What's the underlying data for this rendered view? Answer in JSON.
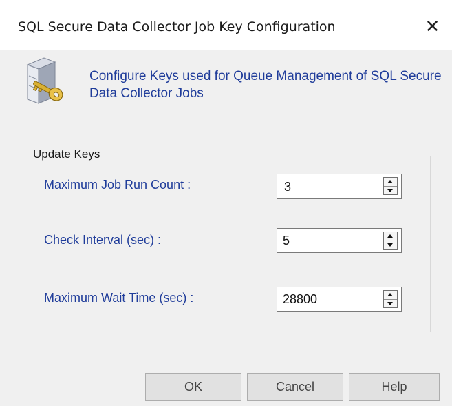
{
  "window": {
    "title": "SQL Secure Data Collector Job Key Configuration",
    "close_glyph": "✕"
  },
  "header": {
    "icon": "server-key-icon",
    "text": "Configure Keys used for Queue Management of SQL Secure Data Collector Jobs"
  },
  "update_keys": {
    "legend": "Update Keys",
    "fields": [
      {
        "label": "Maximum Job Run Count :",
        "value": "3"
      },
      {
        "label": "Check Interval (sec) :",
        "value": "5"
      },
      {
        "label": "Maximum Wait Time (sec) :",
        "value": "28800"
      }
    ]
  },
  "buttons": {
    "ok": "OK",
    "cancel": "Cancel",
    "help": "Help"
  },
  "colors": {
    "label_blue": "#1f3c9a",
    "dialog_bg": "#f0f0f0",
    "button_bg": "#e1e1e1"
  }
}
